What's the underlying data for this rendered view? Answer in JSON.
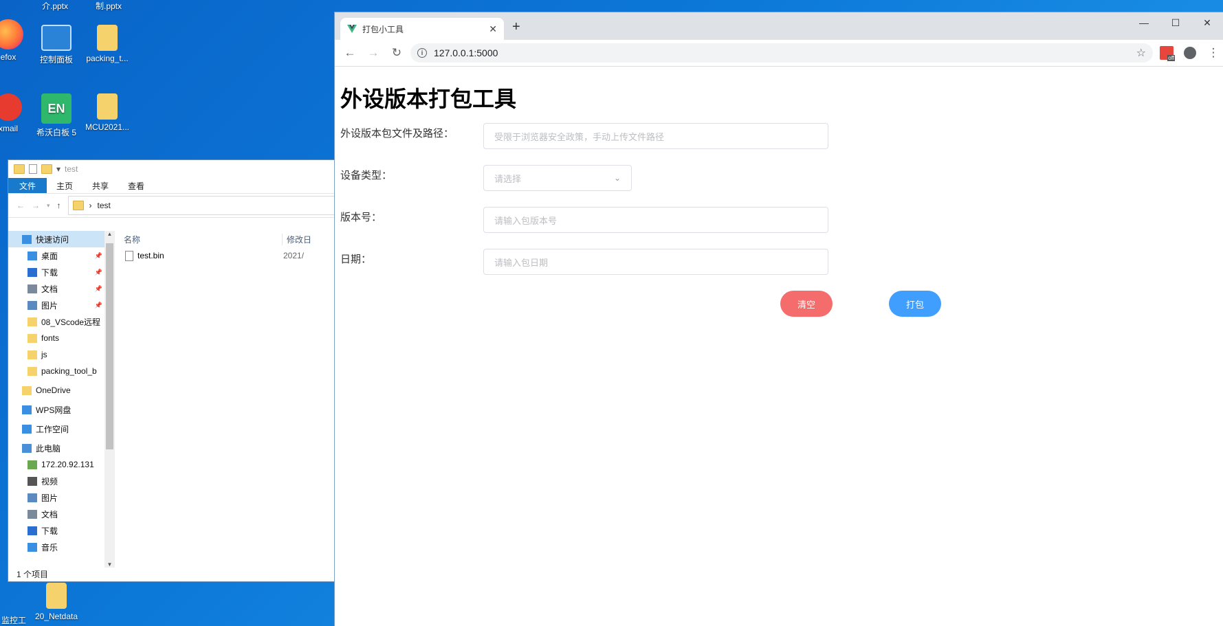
{
  "desktop": {
    "icons": [
      {
        "label": "efox"
      },
      {
        "label": "控制面板"
      },
      {
        "label": "packing_t..."
      },
      {
        "label": "xmail"
      },
      {
        "label": "希沃白板 5"
      },
      {
        "label": "MCU2021..."
      },
      {
        "label": "监控工"
      },
      {
        "label": "20_Netdata"
      }
    ],
    "top_labels": [
      "介.pptx",
      "制.pptx"
    ]
  },
  "explorer": {
    "title": "test",
    "ribbon_tabs": [
      "文件",
      "主页",
      "共享",
      "查看"
    ],
    "address": "test",
    "nav_items": [
      {
        "label": "快速访问",
        "icon": "star-icon"
      },
      {
        "label": "桌面",
        "icon": "desktop-icon",
        "pinned": true
      },
      {
        "label": "下载",
        "icon": "download-icon",
        "pinned": true
      },
      {
        "label": "文档",
        "icon": "document-icon",
        "pinned": true
      },
      {
        "label": "图片",
        "icon": "picture-icon",
        "pinned": true
      },
      {
        "label": "08_VScode远程",
        "icon": "folder-icon"
      },
      {
        "label": "fonts",
        "icon": "folder-icon"
      },
      {
        "label": "js",
        "icon": "folder-icon"
      },
      {
        "label": "packing_tool_b",
        "icon": "folder-icon"
      },
      {
        "label": "OneDrive",
        "icon": "folder-icon"
      },
      {
        "label": "WPS网盘",
        "icon": "cloud-icon"
      },
      {
        "label": "工作空间",
        "icon": "diamond-icon"
      },
      {
        "label": "此电脑",
        "icon": "computer-icon"
      },
      {
        "label": "172.20.92.131",
        "icon": "network-drive-icon"
      },
      {
        "label": "视频",
        "icon": "video-icon"
      },
      {
        "label": "图片",
        "icon": "picture-icon"
      },
      {
        "label": "文档",
        "icon": "document-icon"
      },
      {
        "label": "下载",
        "icon": "download-icon"
      },
      {
        "label": "音乐",
        "icon": "music-icon"
      }
    ],
    "columns": [
      "名称",
      "修改日"
    ],
    "files": [
      {
        "name": "test.bin",
        "modified": "2021/"
      }
    ],
    "status": "1 个项目"
  },
  "browser": {
    "tab_title": "打包小工具",
    "url": "127.0.0.1:5000",
    "page": {
      "heading": "外设版本打包工具",
      "fields": {
        "path_label": "外设版本包文件及路径：",
        "path_placeholder": "受限于浏览器安全政策，手动上传文件路径",
        "device_label": "设备类型：",
        "device_placeholder": "请选择",
        "version_label": "版本号：",
        "version_placeholder": "请输入包版本号",
        "date_label": "日期：",
        "date_placeholder": "请输入包日期"
      },
      "buttons": {
        "clear": "清空",
        "pack": "打包"
      },
      "colors": {
        "clear": "#f56c6c",
        "pack": "#409eff"
      }
    }
  }
}
